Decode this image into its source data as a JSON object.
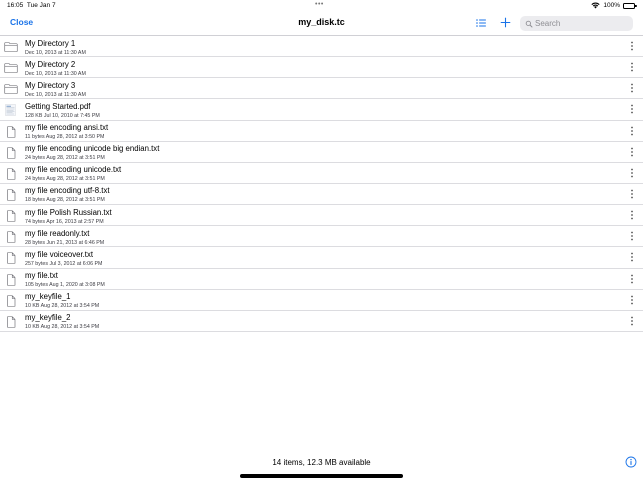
{
  "status_bar": {
    "time": "16:05",
    "date": "Tue Jan 7",
    "battery": "100%",
    "icons": [
      "wifi-icon",
      "battery-icon"
    ]
  },
  "nav": {
    "close_label": "Close",
    "title": "my_disk.tc",
    "search_placeholder": "Search",
    "icons": [
      "list-icon",
      "plus-icon",
      "search-icon"
    ]
  },
  "files": [
    {
      "name": "My Directory 1",
      "meta": "Dec 10, 2013 at 11:30 AM",
      "kind": "folder"
    },
    {
      "name": "My Directory 2",
      "meta": "Dec 10, 2013 at 11:30 AM",
      "kind": "folder"
    },
    {
      "name": "My Directory 3",
      "meta": "Dec 10, 2013 at 11:30 AM",
      "kind": "folder"
    },
    {
      "name": "Getting Started.pdf",
      "meta": "128 KB  Jul 10, 2010 at 7:45 PM",
      "kind": "pdf"
    },
    {
      "name": "my file encoding ansi.txt",
      "meta": "11 bytes  Aug 28, 2012 at 3:50 PM",
      "kind": "file"
    },
    {
      "name": "my file encoding unicode big endian.txt",
      "meta": "24 bytes  Aug 28, 2012 at 3:51 PM",
      "kind": "file"
    },
    {
      "name": "my file encoding unicode.txt",
      "meta": "24 bytes  Aug 28, 2012 at 3:51 PM",
      "kind": "file"
    },
    {
      "name": "my file encoding utf-8.txt",
      "meta": "18 bytes  Aug 28, 2012 at 3:51 PM",
      "kind": "file"
    },
    {
      "name": "my file Polish Russian.txt",
      "meta": "74 bytes  Apr 16, 2013 at 2:57 PM",
      "kind": "file"
    },
    {
      "name": "my file readonly.txt",
      "meta": "28 bytes  Jun 21, 2013 at 6:46 PM",
      "kind": "file"
    },
    {
      "name": "my file voiceover.txt",
      "meta": "257 bytes  Jul 3, 2012 at 6:06 PM",
      "kind": "file"
    },
    {
      "name": "my file.txt",
      "meta": "105 bytes  Aug 1, 2020 at 3:08 PM",
      "kind": "file"
    },
    {
      "name": "my_keyfile_1",
      "meta": "10 KB  Aug 28, 2012 at 3:54 PM",
      "kind": "file"
    },
    {
      "name": "my_keyfile_2",
      "meta": "10 KB  Aug 28, 2012 at 3:54 PM",
      "kind": "file"
    }
  ],
  "footer": {
    "status": "14 items, 12.3 MB available",
    "icon": "info-icon"
  },
  "colors": {
    "accent": "#1a73e8",
    "separator": "#dcdce0",
    "search_bg": "#ececef"
  }
}
